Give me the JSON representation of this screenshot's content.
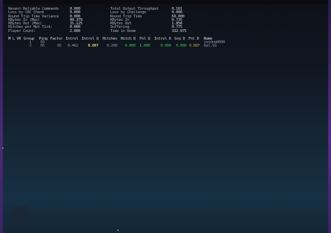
{
  "stats": {
    "left": [
      {
        "label": "Resent Reliable Commands",
        "value": "0.000"
      },
      {
        "label": "Loss by CRC Check",
        "value": "0.000"
      },
      {
        "label": "Round Trip Time Variance",
        "value": "0.000"
      },
      {
        "label": "KBytes In (Max)",
        "value": "40.379"
      },
      {
        "label": "KBytes Out (Max)",
        "value": "31.125"
      },
      {
        "label": "Hitches per Net Tick:",
        "value": "0.000"
      },
      {
        "label": "Player Count:",
        "value": "2.000"
      }
    ],
    "right": [
      {
        "label": "Total Output Throughput",
        "value": "0.161"
      },
      {
        "label": "Loss by Challenge",
        "value": "0.000"
      },
      {
        "label": "Round Trip Time",
        "value": "69.000"
      },
      {
        "label": "KBytes In",
        "value": "0.735"
      },
      {
        "label": "KBytes Out",
        "value": "1.858"
      },
      {
        "label": "Suffering",
        "value": "0.775"
      },
      {
        "label": "Time in Room",
        "value": "332.975"
      }
    ]
  },
  "table": {
    "headers": [
      "M",
      "L",
      "VR",
      "Group",
      "Ping",
      "Factor",
      "Intrvl",
      "Intrvl Q",
      "Hitches",
      "Hitch Q",
      "Fnl Q",
      "Intrvl D",
      "Grp D",
      "Fnl D",
      "Name"
    ],
    "rows": [
      {
        "group": "1",
        "ping": "65",
        "factor": "",
        "intrvl": "",
        "intrvl_q": "",
        "hitches": "",
        "hitch_q": "",
        "fnl_q": "",
        "intrvl_d": "",
        "grp_d": "",
        "fnl_d": "",
        "name": "jetdog0000"
      },
      {
        "group": "2",
        "ping": "65",
        "factor": "95",
        "intrvl": "0.462",
        "intrvl_q": "0.087",
        "hitches": "0.200",
        "hitch_q": "0.000",
        "fnl_q": "1.000",
        "intrvl_d": "0.000",
        "grp_d": "0.000",
        "fnl_d": "0.087",
        "name": "Gal.Va"
      }
    ]
  },
  "colors": {
    "yellow": "#f0e26a",
    "green": "#3fcf5a",
    "orange": "#d8b24a"
  }
}
